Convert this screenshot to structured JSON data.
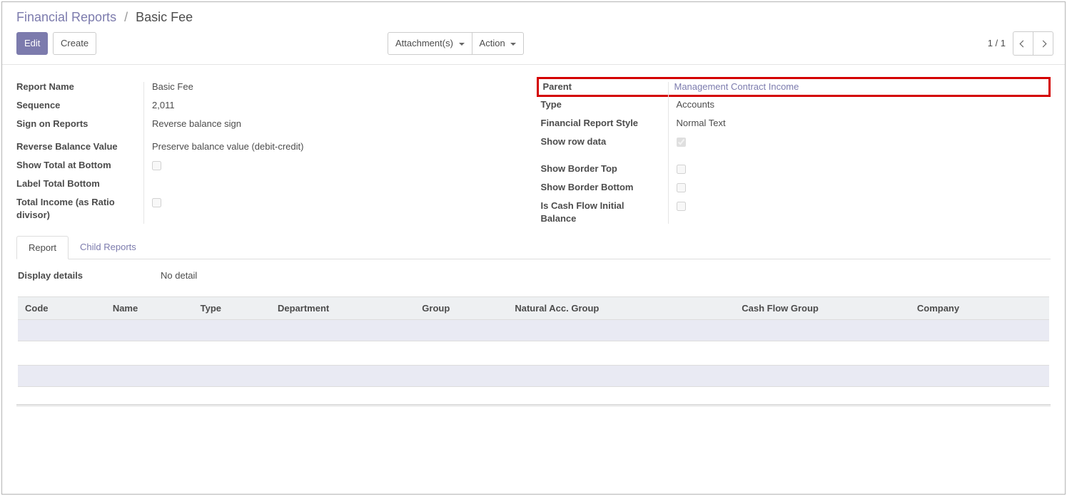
{
  "breadcrumb": {
    "parent": "Financial Reports",
    "current": "Basic Fee"
  },
  "buttons": {
    "edit": "Edit",
    "create": "Create",
    "attachments": "Attachment(s)",
    "action": "Action"
  },
  "pager": {
    "text": "1 / 1"
  },
  "fields_left": {
    "report_name": {
      "label": "Report Name",
      "value": "Basic Fee"
    },
    "sequence": {
      "label": "Sequence",
      "value": "2,011"
    },
    "sign_on_reports": {
      "label": "Sign on Reports",
      "value": "Reverse balance sign"
    },
    "reverse_balance_value": {
      "label": "Reverse Balance Value",
      "value": "Preserve balance value (debit-credit)"
    },
    "show_total_at_bottom": {
      "label": "Show Total at Bottom",
      "checked": false
    },
    "label_total_bottom": {
      "label": "Label Total Bottom",
      "value": ""
    },
    "total_income_ratio": {
      "label": "Total Income (as Ratio divisor)",
      "checked": false
    }
  },
  "fields_right": {
    "parent": {
      "label": "Parent",
      "value": "Management Contract Income"
    },
    "type": {
      "label": "Type",
      "value": "Accounts"
    },
    "financial_report_style": {
      "label": "Financial Report Style",
      "value": "Normal Text"
    },
    "show_row_data": {
      "label": "Show row data",
      "checked": true
    },
    "show_border_top": {
      "label": "Show Border Top",
      "checked": false
    },
    "show_border_bottom": {
      "label": "Show Border Bottom",
      "checked": false
    },
    "is_cash_flow_initial": {
      "label": "Is Cash Flow Initial Balance",
      "checked": false
    }
  },
  "tabs": {
    "report": "Report",
    "child_reports": "Child Reports"
  },
  "report_tab": {
    "display_details": {
      "label": "Display details",
      "value": "No detail"
    },
    "columns": {
      "code": "Code",
      "name": "Name",
      "type": "Type",
      "department": "Department",
      "group": "Group",
      "natural_acc_group": "Natural Acc. Group",
      "cash_flow_group": "Cash Flow Group",
      "company": "Company"
    }
  }
}
